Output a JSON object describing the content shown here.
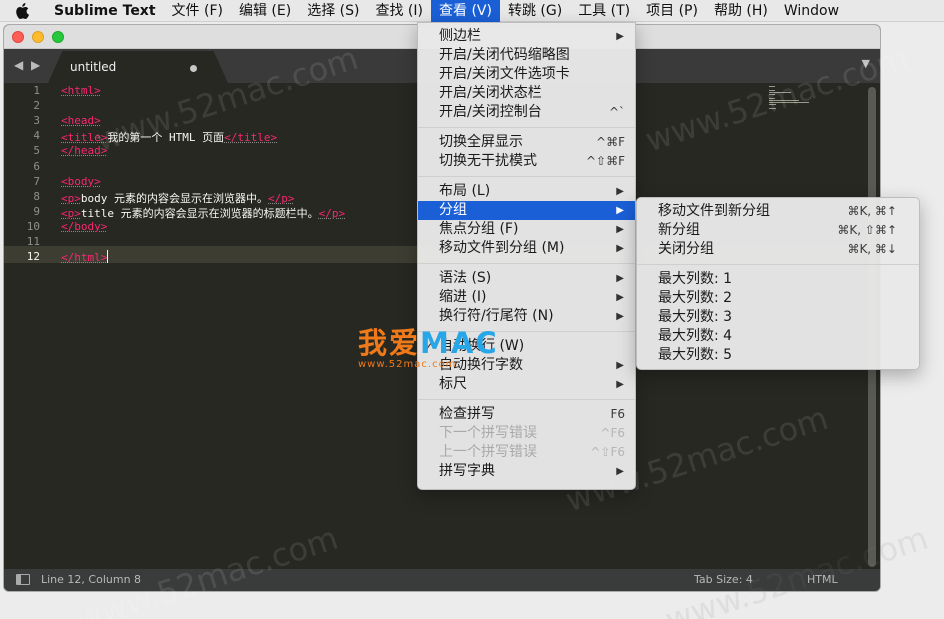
{
  "menubar": {
    "app_name": "Sublime Text",
    "items": [
      "文件 (F)",
      "编辑 (E)",
      "选择 (S)",
      "查找 (I)",
      "查看 (V)",
      "转跳 (G)",
      "工具 (T)",
      "项目 (P)",
      "帮助 (H)",
      "Window"
    ],
    "active": "查看 (V)"
  },
  "tab": {
    "name": "untitled"
  },
  "editor": {
    "line_numbers": [
      "1",
      "2",
      "3",
      "4",
      "5",
      "6",
      "7",
      "8",
      "9",
      "10",
      "11",
      "12"
    ],
    "current_line": "12",
    "lines": [
      [
        {
          "t": "tag",
          "v": "<html>"
        }
      ],
      [],
      [
        {
          "t": "tag",
          "v": "<head>"
        }
      ],
      [
        {
          "t": "tag",
          "v": "<title>"
        },
        {
          "t": "txt",
          "v": "我的第一个 HTML 页面"
        },
        {
          "t": "tag",
          "v": "</title>"
        }
      ],
      [
        {
          "t": "tag",
          "v": "</head>"
        }
      ],
      [],
      [
        {
          "t": "tag",
          "v": "<body>"
        }
      ],
      [
        {
          "t": "tag",
          "v": "<p>"
        },
        {
          "t": "txt",
          "v": "body 元素的内容会显示在浏览器中。"
        },
        {
          "t": "tag",
          "v": "</p>"
        }
      ],
      [
        {
          "t": "tag",
          "v": "<p>"
        },
        {
          "t": "txt",
          "v": "title 元素的内容会显示在浏览器的标题栏中。"
        },
        {
          "t": "tag",
          "v": "</p>"
        }
      ],
      [
        {
          "t": "tag",
          "v": "</body>"
        }
      ],
      [],
      [
        {
          "t": "tag",
          "v": "</html>"
        }
      ]
    ]
  },
  "statusbar": {
    "position": "Line 12, Column 8",
    "tab_size": "Tab Size: 4",
    "syntax": "HTML"
  },
  "view_menu": {
    "items": [
      {
        "label": "侧边栏",
        "arrow": true
      },
      {
        "label": "开启/关闭代码缩略图"
      },
      {
        "label": "开启/关闭文件选项卡"
      },
      {
        "label": "开启/关闭状态栏"
      },
      {
        "label": "开启/关闭控制台",
        "shortcut": "^`"
      },
      {
        "sep": true
      },
      {
        "label": "切换全屏显示",
        "shortcut": "^⌘F"
      },
      {
        "label": "切换无干扰模式",
        "shortcut": "^⇧⌘F"
      },
      {
        "sep": true
      },
      {
        "label": "布局 (L)",
        "arrow": true
      },
      {
        "label": "分组",
        "arrow": true,
        "highlighted": true
      },
      {
        "label": "焦点分组 (F)",
        "arrow": true
      },
      {
        "label": "移动文件到分组 (M)",
        "arrow": true
      },
      {
        "sep": true
      },
      {
        "label": "语法 (S)",
        "arrow": true
      },
      {
        "label": "缩进 (I)",
        "arrow": true
      },
      {
        "label": "换行符/行尾符 (N)",
        "arrow": true
      },
      {
        "sep": true
      },
      {
        "label": "自动换行 (W)",
        "checked": true
      },
      {
        "label": "自动换行字数",
        "arrow": true
      },
      {
        "label": "标尺",
        "arrow": true
      },
      {
        "sep": true
      },
      {
        "label": "检查拼写",
        "shortcut": "F6"
      },
      {
        "label": "下一个拼写错误",
        "shortcut": "^F6",
        "disabled": true
      },
      {
        "label": "上一个拼写错误",
        "shortcut": "^⇧F6",
        "disabled": true
      },
      {
        "label": "拼写字典",
        "arrow": true
      }
    ]
  },
  "group_menu": {
    "items": [
      {
        "label": "移动文件到新分组",
        "shortcut": "⌘K, ⌘↑"
      },
      {
        "label": "新分组",
        "shortcut": "⌘K, ⇧⌘↑"
      },
      {
        "label": "关闭分组",
        "shortcut": "⌘K, ⌘↓"
      },
      {
        "sep": true
      },
      {
        "label": "最大列数: 1"
      },
      {
        "label": "最大列数: 2"
      },
      {
        "label": "最大列数: 3"
      },
      {
        "label": "最大列数: 4"
      },
      {
        "label": "最大列数: 5"
      }
    ]
  },
  "watermark": {
    "text": "www.52mac.com",
    "logo_main": "我爱",
    "logo_mac": "MAC",
    "logo_sub": "www.52mac.com"
  }
}
